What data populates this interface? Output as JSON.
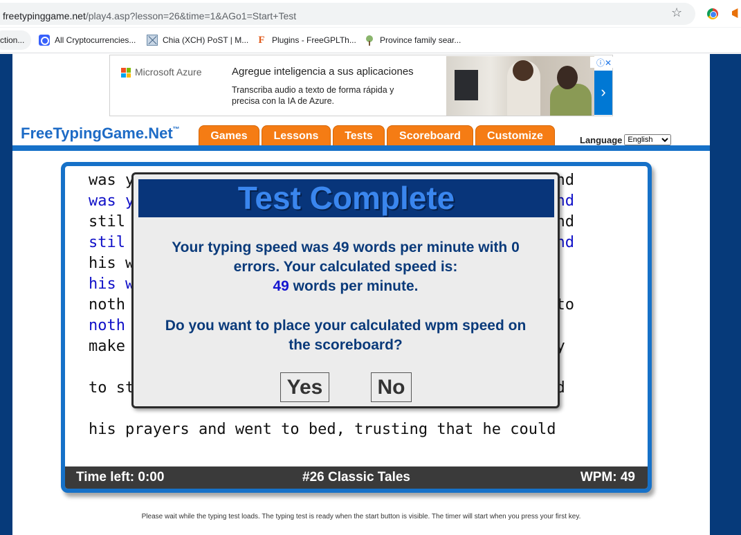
{
  "browser": {
    "url_host": "freetypinggame.net",
    "url_path": "/play4.asp?lesson=26&time=1&AGo1=Start+Test",
    "bookmarks": [
      {
        "label": "ction...",
        "icon": "page-icon"
      },
      {
        "label": "All Cryptocurrencies...",
        "icon": "coinmarketcap-icon"
      },
      {
        "label": "Chia (XCH) PoST | M...",
        "icon": "chia-icon"
      },
      {
        "label": "Plugins - FreeGPLTh...",
        "icon": "f-logo-icon"
      },
      {
        "label": "Province family sear...",
        "icon": "tree-icon"
      }
    ]
  },
  "ad": {
    "brand": "Microsoft Azure",
    "headline": "Agregue inteligencia a sus aplicaciones",
    "body": "Transcriba audio a texto de forma rápida y precisa con la IA de Azure.",
    "arrow": "›",
    "choices": "ⓘ✕"
  },
  "site": {
    "logo": "FreeTypingGame.Net",
    "logo_tm": "™",
    "tabs": [
      "Games",
      "Lessons",
      "Tests",
      "Scoreboard",
      "Customize"
    ],
    "language_label": "Language",
    "language_value": "English"
  },
  "typing": {
    "lines": [
      {
        "text": "was y                                              nd",
        "style": "black"
      },
      {
        "text": "was y                                              nd",
        "style": "blue"
      },
      {
        "text": "stil                                              and",
        "style": "black"
      },
      {
        "text": "stil                                              and",
        "style": "blue"
      },
      {
        "text": "his w",
        "style": "black"
      },
      {
        "text": "his w",
        "style": "blue"
      },
      {
        "text": "noth                                            gh to",
        "style": "black"
      },
      {
        "text": "noth",
        "style": "blue"
      },
      {
        "text": "make                                            eady",
        "style": "black"
      },
      {
        "text": "",
        "style": "black"
      },
      {
        "text": "to st                                           said",
        "style": "black"
      },
      {
        "text": "",
        "style": "black"
      },
      {
        "text": "his prayers and went to bed, trusting that he could",
        "style": "black"
      }
    ],
    "status": {
      "time_left": "Time left: 0:00",
      "lesson": "#26 Classic Tales",
      "wpm": "WPM: 49"
    }
  },
  "dialog": {
    "title": "Test Complete",
    "msg_line1": "Your typing speed was 49 words per minute with 0",
    "msg_line2": "errors. Your calculated speed is:",
    "calc_wpm": "49",
    "msg_line3_suffix": " words per minute.",
    "question_line1": "Do you want to place your calculated wpm speed on",
    "question_line2": "the scoreboard?",
    "yes_label": "Yes",
    "no_label": "No"
  },
  "footer": {
    "note": "Please wait while the typing test loads. The typing test is ready when the start button is visible. The timer will start when you press your first key."
  },
  "colors": {
    "page_bg": "#063a7a",
    "accent_blue": "#1671c8",
    "tab_orange": "#f57c14",
    "dialog_title_bg": "#08357a",
    "dialog_text": "#0a3a7a"
  }
}
